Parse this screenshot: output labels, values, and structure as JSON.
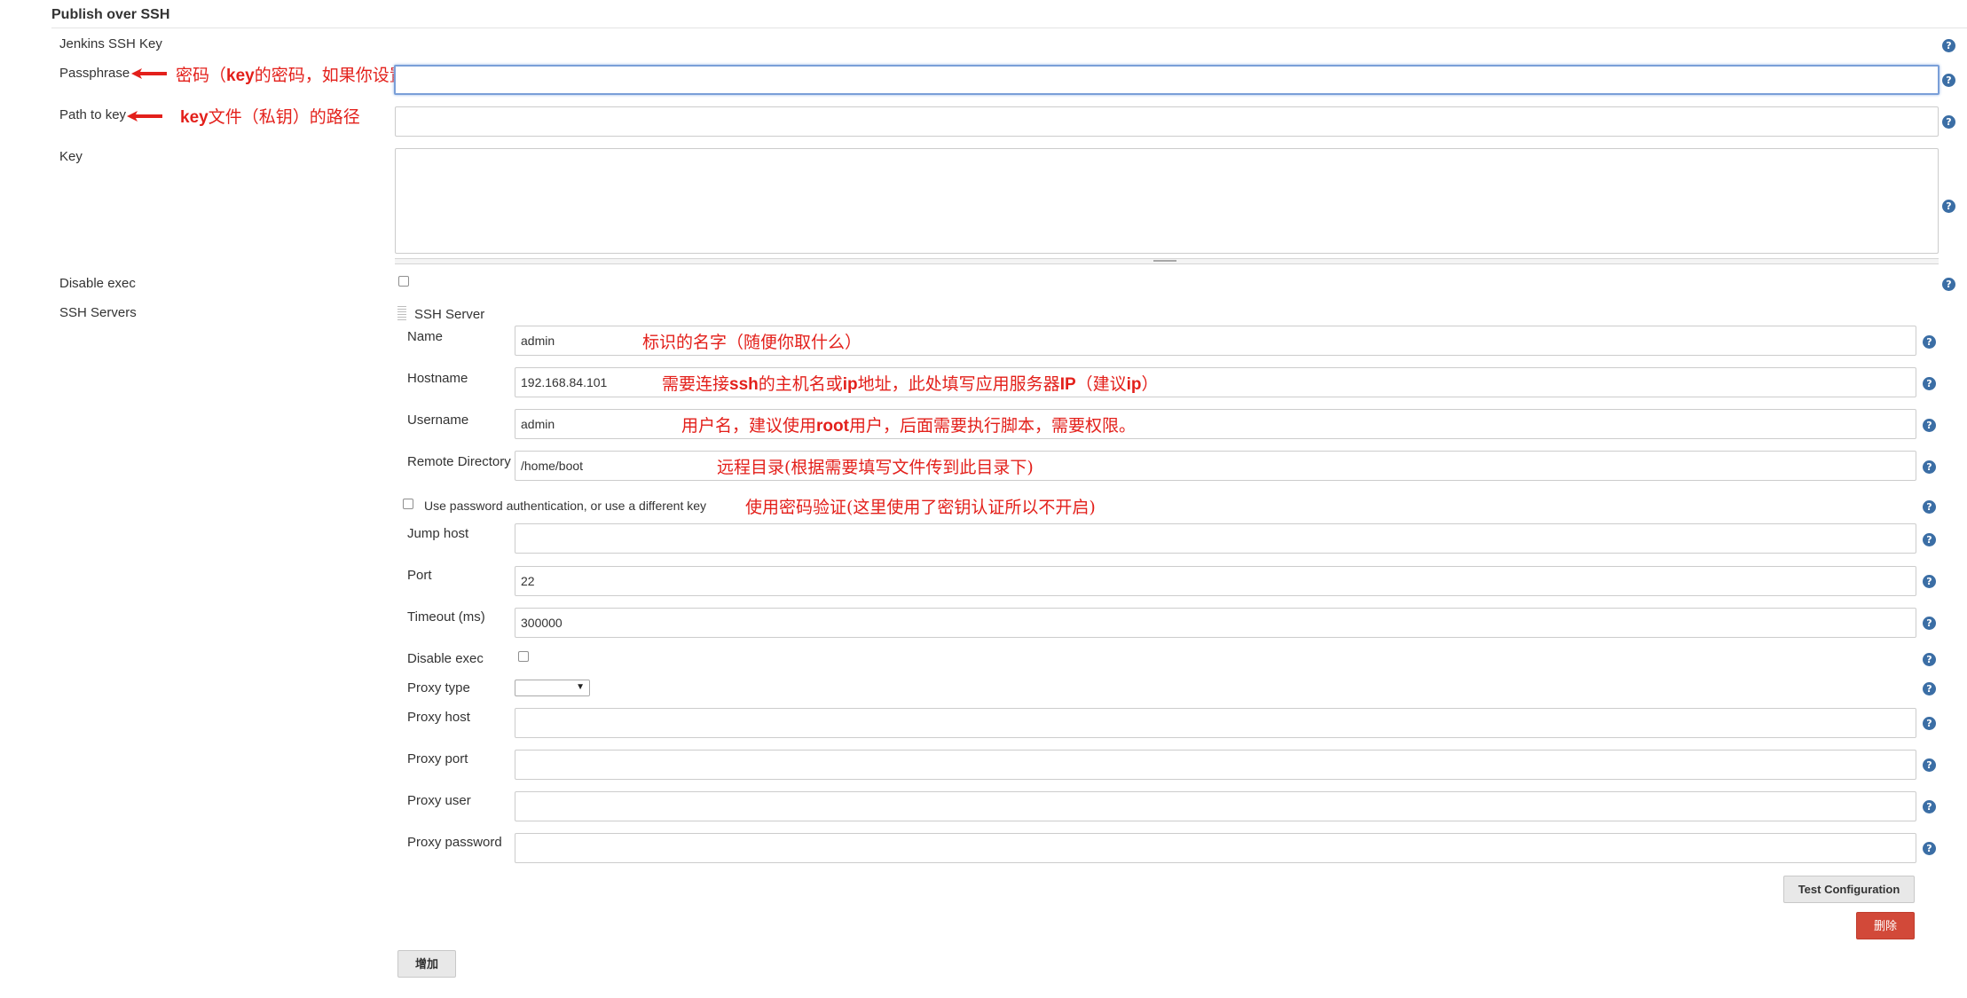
{
  "section": {
    "title": "Publish over SSH"
  },
  "fields": {
    "jenkins_ssh_key": "Jenkins SSH Key",
    "passphrase": "Passphrase",
    "path_to_key": "Path to key",
    "key": "Key",
    "disable_exec": "Disable exec",
    "ssh_servers": "SSH Servers"
  },
  "annotations": {
    "passphrase_note": [
      "密码（",
      "key",
      "的密码，如果你设置了）"
    ],
    "path_note": [
      "key",
      "文件（私钥）的路径"
    ],
    "name_note": "标识的名字（随便你取什么）",
    "hostname_note": [
      "需要连接",
      "ssh",
      "的主机名或",
      "ip",
      "地址，此处填写应用服务器",
      "IP",
      "（建议",
      "ip",
      "）"
    ],
    "username_note": [
      "用户名，建议使用",
      "root",
      "用户，后面需要执行脚本，需要权限。"
    ],
    "remote_dir_note": "远程目录(根据需要填写文件传到此目录下)",
    "password_auth_note": "使用密码验证(这里使用了密钥认证所以不开启)"
  },
  "ssh_server": {
    "header": "SSH Server",
    "name_label": "Name",
    "name_value": "admin",
    "hostname_label": "Hostname",
    "hostname_value": "192.168.84.101",
    "username_label": "Username",
    "username_value": "admin",
    "remote_dir_label": "Remote Directory",
    "remote_dir_value": "/home/boot",
    "password_auth_label": "Use password authentication, or use a different key",
    "jump_host_label": "Jump host",
    "port_label": "Port",
    "port_value": "22",
    "timeout_label": "Timeout (ms)",
    "timeout_value": "300000",
    "disable_exec_label": "Disable exec",
    "proxy_type_label": "Proxy type",
    "proxy_host_label": "Proxy host",
    "proxy_port_label": "Proxy port",
    "proxy_user_label": "Proxy user",
    "proxy_password_label": "Proxy password"
  },
  "buttons": {
    "test_configuration": "Test Configuration",
    "delete": "删除",
    "add": "增加"
  },
  "help_glyph": "?",
  "colors": {
    "annotation": "#e3201b",
    "help_icon": "#3b6ea5",
    "delete_button": "#d24939"
  }
}
